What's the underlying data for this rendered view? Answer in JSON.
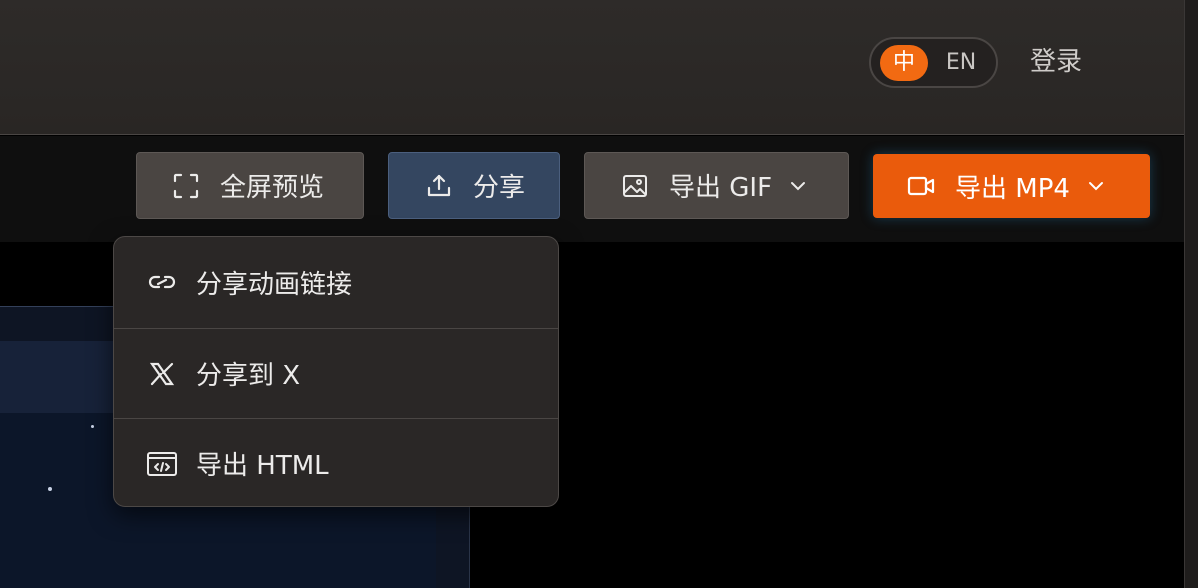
{
  "header": {
    "lang_zh": "中",
    "lang_en": "EN",
    "login": "登录"
  },
  "toolbar": {
    "fullscreen_label": "全屏预览",
    "share_label": "分享",
    "export_gif_label": "导出 GIF",
    "export_mp4_label": "导出 MP4"
  },
  "share_menu": {
    "items": [
      {
        "label": "分享动画链接",
        "icon": "link-icon"
      },
      {
        "label": "分享到 X",
        "icon": "x-logo-icon"
      },
      {
        "label": "导出 HTML",
        "icon": "code-window-icon"
      }
    ]
  },
  "colors": {
    "accent": "#ea5b0c",
    "share_button": "#344660",
    "lang_active": "#f26a12"
  }
}
